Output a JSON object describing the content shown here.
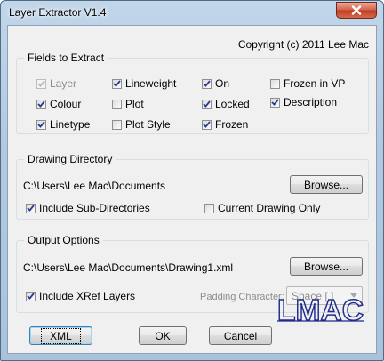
{
  "window": {
    "title": "Layer Extractor V1.4"
  },
  "copyright": "Copyright (c) 2011 Lee Mac",
  "fields": {
    "title": "Fields to Extract",
    "items": [
      {
        "label": "Layer",
        "checked": true,
        "disabled": true
      },
      {
        "label": "Lineweight",
        "checked": true
      },
      {
        "label": "On",
        "checked": true
      },
      {
        "label": "Frozen in VP",
        "checked": false
      },
      {
        "label": "Colour",
        "checked": true
      },
      {
        "label": "Plot",
        "checked": false
      },
      {
        "label": "Locked",
        "checked": true
      },
      {
        "label": "Description",
        "checked": true
      },
      {
        "label": "Linetype",
        "checked": true
      },
      {
        "label": "Plot Style",
        "checked": false
      },
      {
        "label": "Frozen",
        "checked": true
      }
    ]
  },
  "drawing_directory": {
    "title": "Drawing Directory",
    "path": "C:\\Users\\Lee Mac\\Documents",
    "browse_label": "Browse...",
    "include_subdirs": {
      "label": "Include Sub-Directories",
      "checked": true
    },
    "current_only": {
      "label": "Current Drawing Only",
      "checked": false
    }
  },
  "output_options": {
    "title": "Output Options",
    "path": "C:\\Users\\Lee Mac\\Documents\\Drawing1.xml",
    "browse_label": "Browse...",
    "include_xref": {
      "label": "Include XRef Layers",
      "checked": true
    },
    "padding_label": "Padding Character:",
    "padding_value": "Space [  ]"
  },
  "buttons": {
    "xml": "XML",
    "ok": "OK",
    "cancel": "Cancel"
  },
  "logo_text": "LMAC",
  "colors": {
    "logo_blue": "#1f2a8a",
    "close_red": "#c03e24"
  },
  "icons": {
    "close": "close-icon",
    "check": "checkmark-icon",
    "dropdown": "chevron-down-icon"
  }
}
